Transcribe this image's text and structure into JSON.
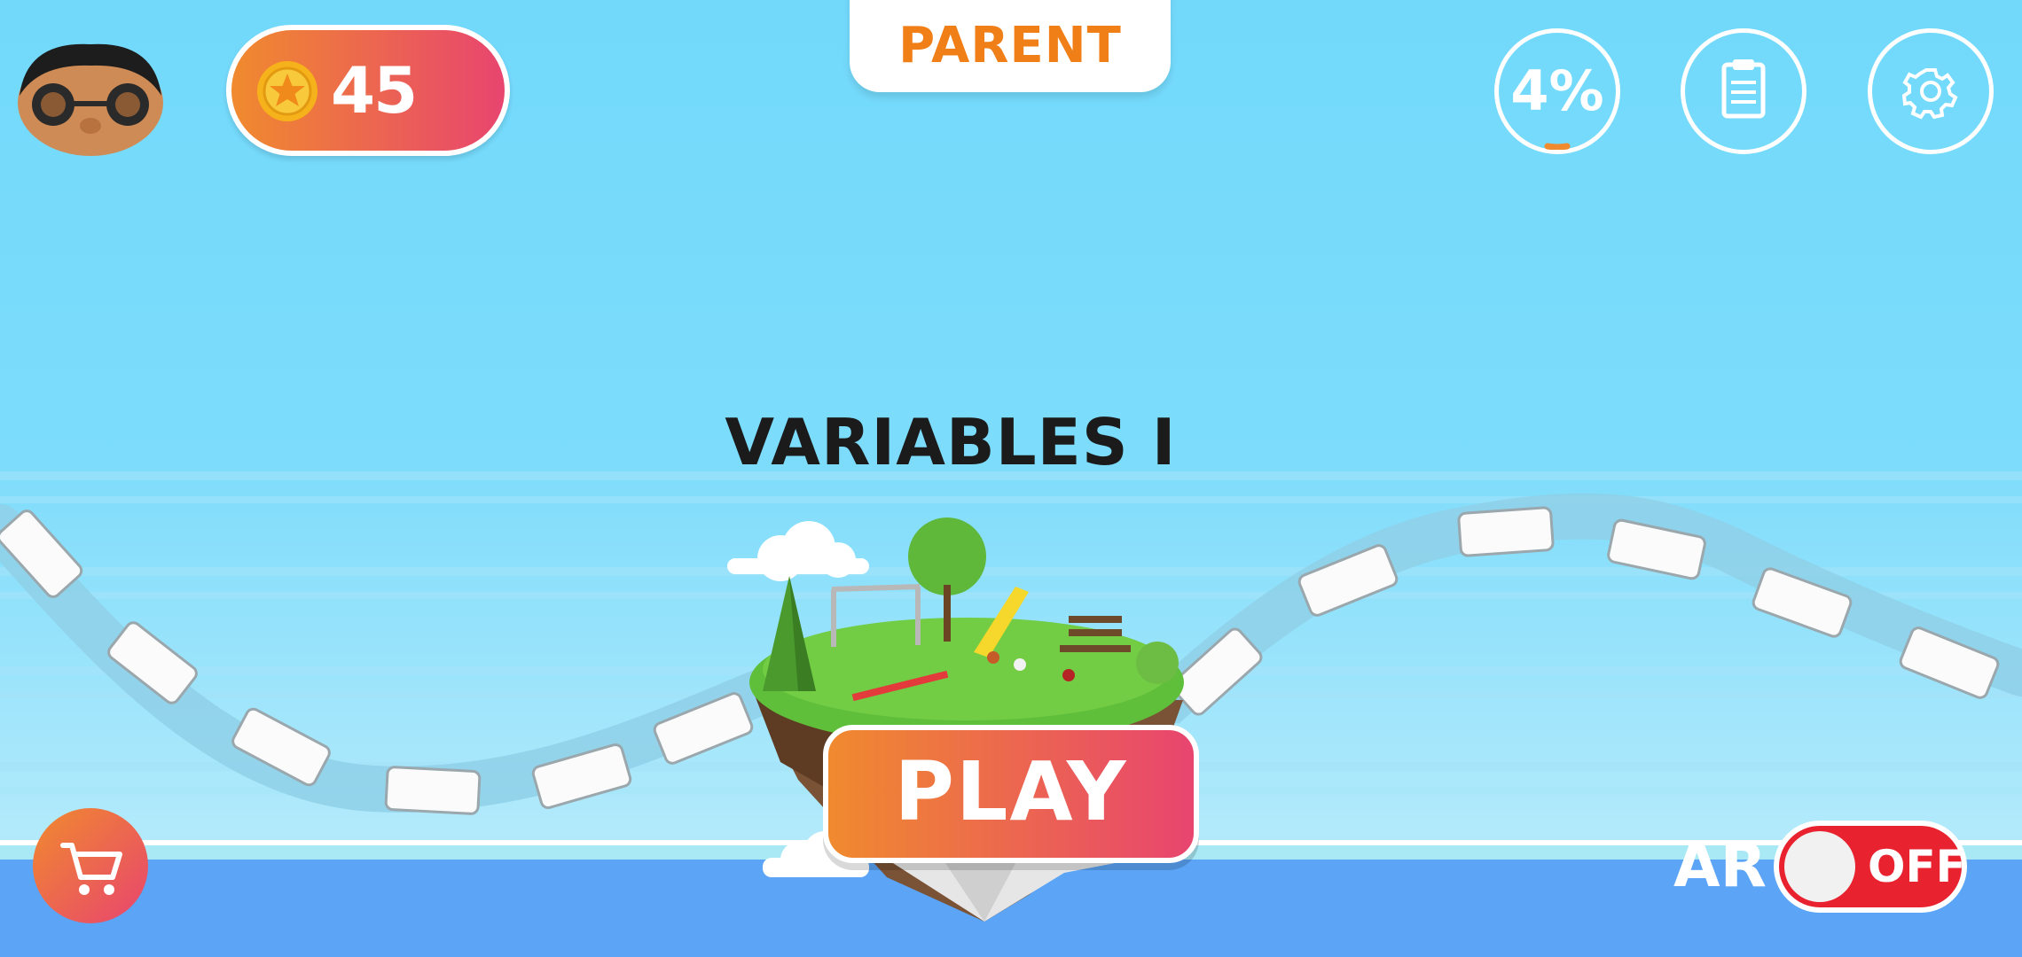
{
  "header": {
    "coins": "45",
    "mode_tab": "PARENT",
    "progress_label": "4%",
    "progress_value": 0.04
  },
  "level": {
    "title": "VARIABLES I"
  },
  "controls": {
    "play_label": "PLAY",
    "ar_label": "AR",
    "ar_state": "OFF"
  },
  "icons": {
    "coin": "star-coin-icon",
    "report": "clipboard-icon",
    "settings": "gear-icon",
    "cart": "shopping-cart-icon"
  },
  "colors": {
    "sky_top": "#72d9fb",
    "sky_bottom": "#b6ebfb",
    "sea": "#5ba4f6",
    "accent_orange": "#f08a2e",
    "accent_pink": "#e8456f",
    "toggle_off": "#e8222e",
    "title_text": "#1b1b1b"
  }
}
